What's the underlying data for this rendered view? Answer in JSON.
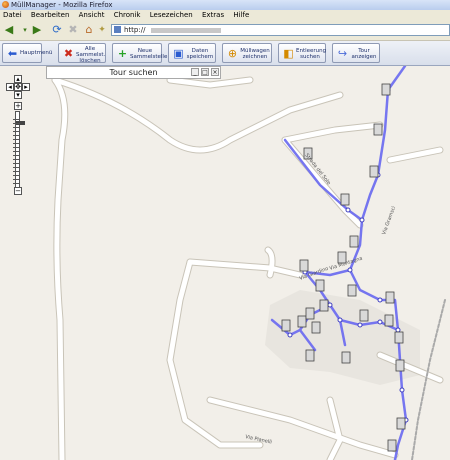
{
  "window": {
    "title": "MüllManager - Mozilla Firefox"
  },
  "menu": [
    "Datei",
    "Bearbeiten",
    "Ansicht",
    "Chronik",
    "Lesezeichen",
    "Extras",
    "Hilfe"
  ],
  "nav": {
    "url": "http://"
  },
  "toolbar": [
    {
      "label": "Hauptmenü",
      "icon": "home-icon",
      "color": "#2a5bd0"
    },
    {
      "label": "Alle\nSammelst.\nlöschen",
      "icon": "delete-icon",
      "color": "#cc2b1d"
    },
    {
      "label": "Neue\nSammelstelle",
      "icon": "add-icon",
      "color": "#27a227"
    },
    {
      "label": "Daten\nspeichern",
      "icon": "save-icon",
      "color": "#2a5bd0"
    },
    {
      "label": "Müllwagen\nzeichnen",
      "icon": "truck-icon",
      "color": "#d48a00"
    },
    {
      "label": "Entleerung\nsuchen",
      "icon": "search-icon",
      "color": "#d48a00"
    },
    {
      "label": "Tour\nanzeigen",
      "icon": "route-icon",
      "color": "#4a6bd8"
    }
  ],
  "tour_panel": {
    "title": "Tour suchen"
  },
  "zoom": {
    "plus": "+",
    "minus": "−",
    "level_fraction": 0.12
  },
  "street_labels": [
    "Strada del Sole",
    "Via Pianelli",
    "Via Giardino",
    "Via Gramsci",
    "Via Montagna"
  ],
  "colors": {
    "route": "#6f6ff0",
    "road": "#ffffff",
    "road_edge": "#c9c4b8",
    "land": "#f2efe9",
    "toolbar": "#dfe4ef"
  }
}
